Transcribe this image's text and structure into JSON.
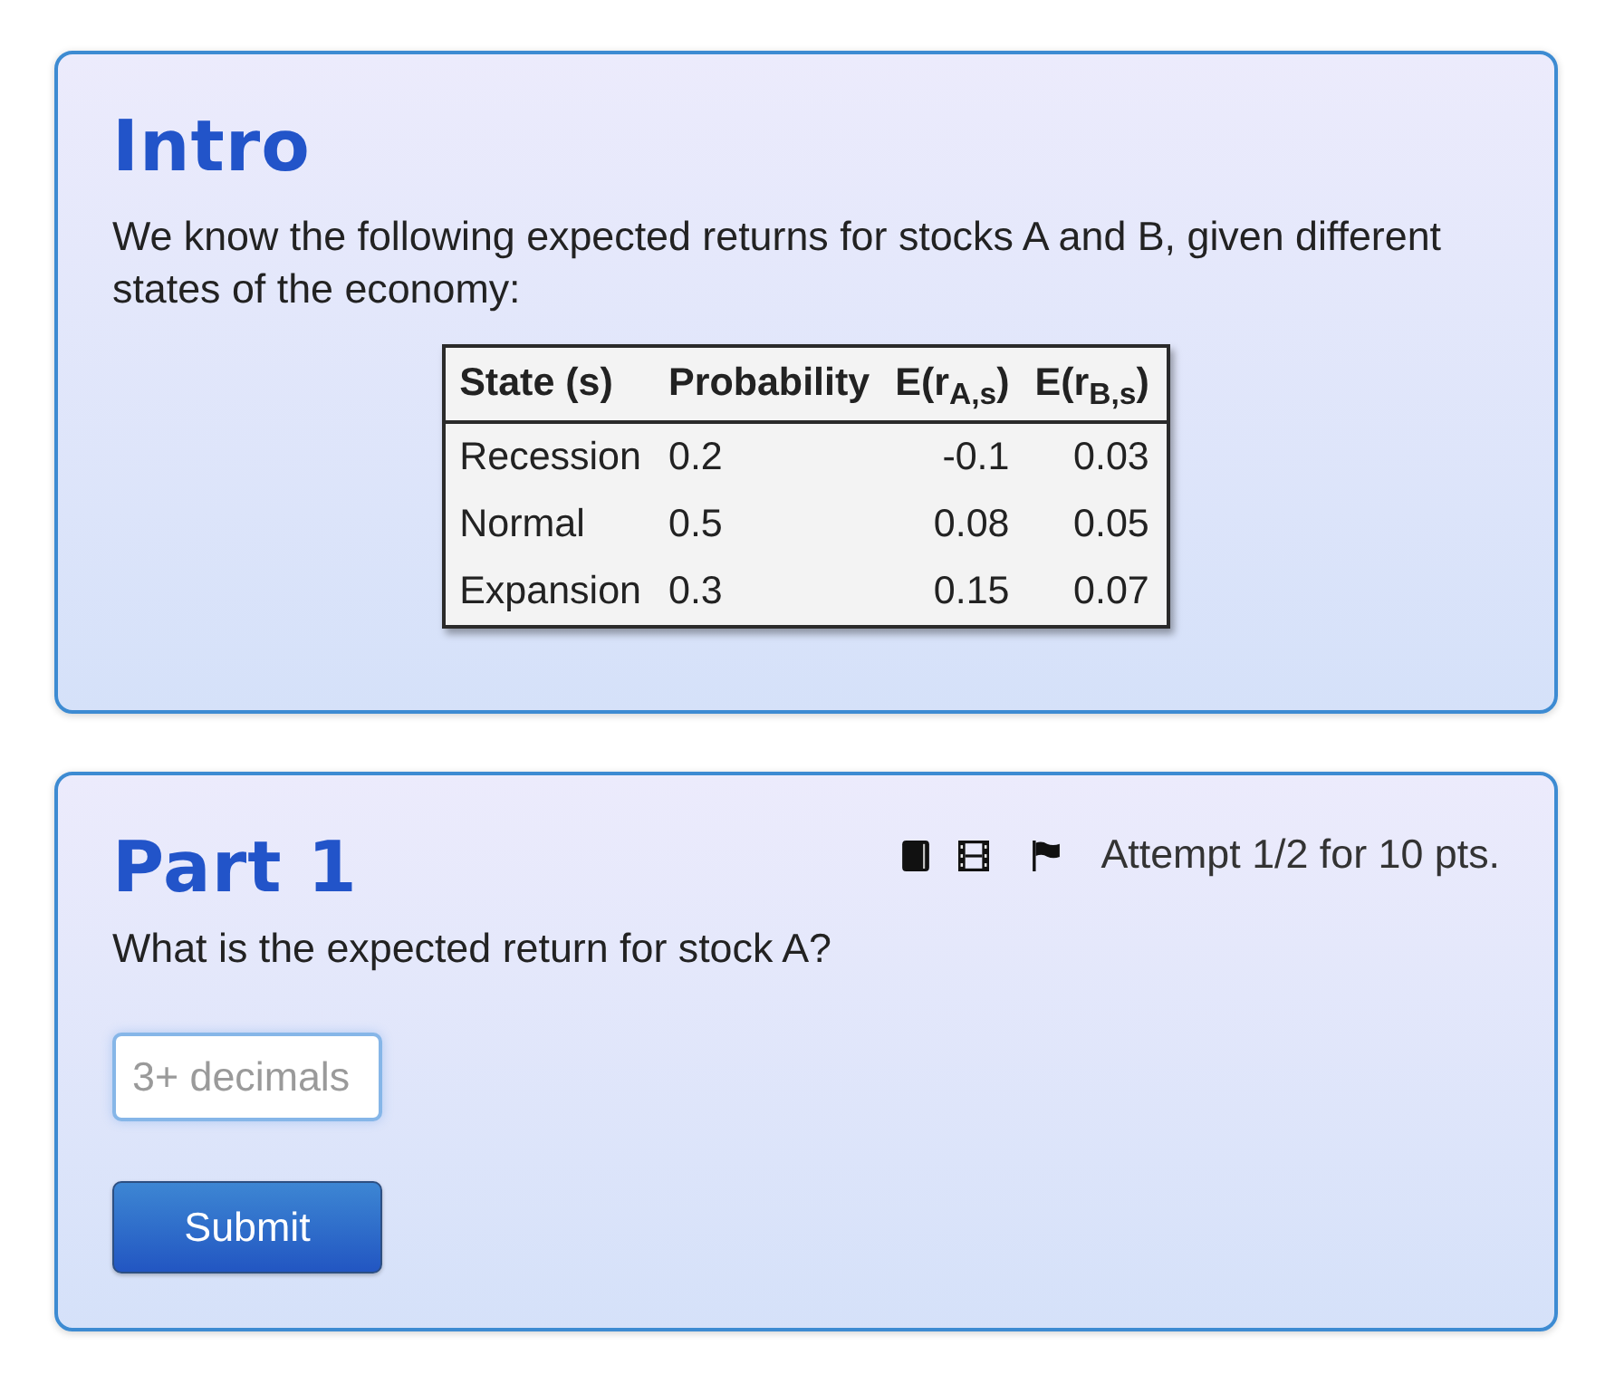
{
  "intro": {
    "title": "Intro",
    "text": "We know the following expected returns for stocks A and B, given different states of the economy:",
    "table": {
      "columns": [
        "State (s)",
        "Probability",
        "E(r$_{A,s}$)",
        "E(r$_{B,s}$)"
      ],
      "rows": [
        [
          "Recession",
          "0.2",
          "-0.1",
          "0.03"
        ],
        [
          "Normal",
          "0.5",
          "0.08",
          "0.05"
        ],
        [
          "Expansion",
          "0.3",
          "0.15",
          "0.07"
        ]
      ]
    }
  },
  "part": {
    "title": "Part 1",
    "attempt": "Attempt 1/2 for 10 pts.",
    "question": "What is the expected return for stock A?",
    "answer": {
      "placeholder": "3+ decimals"
    },
    "submit": "Submit"
  }
}
